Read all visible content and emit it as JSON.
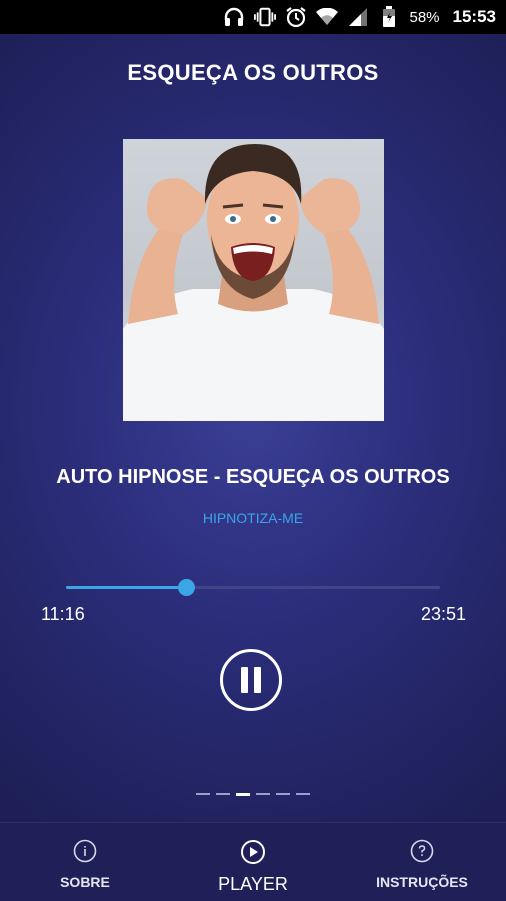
{
  "status_bar": {
    "battery_percent": "58%",
    "time": "15:53",
    "icons": [
      "headphones-icon",
      "vibrate-icon",
      "alarm-icon",
      "wifi-icon",
      "signal-icon",
      "battery-icon"
    ]
  },
  "header": {
    "title": "ESQUEÇA OS OUTROS"
  },
  "player": {
    "track_title": "AUTO HIPNOSE - ESQUEÇA OS OUTROS",
    "artist": "HIPNOTIZA-ME",
    "elapsed": "11:16",
    "duration": "23:51",
    "progress_fraction": 0.32,
    "state_icon": "pause-icon"
  },
  "pager": {
    "count": 6,
    "active_index": 2
  },
  "bottom_nav": {
    "items": [
      {
        "label": "SOBRE",
        "icon": "info-icon"
      },
      {
        "label": "PLAYER",
        "icon": "play-circle-icon"
      },
      {
        "label": "INSTRUÇÕES",
        "icon": "help-icon"
      }
    ],
    "active": "PLAYER"
  },
  "colors": {
    "accent": "#3aa6e6",
    "background": "#2b2d7a",
    "status_bar": "#000000"
  }
}
